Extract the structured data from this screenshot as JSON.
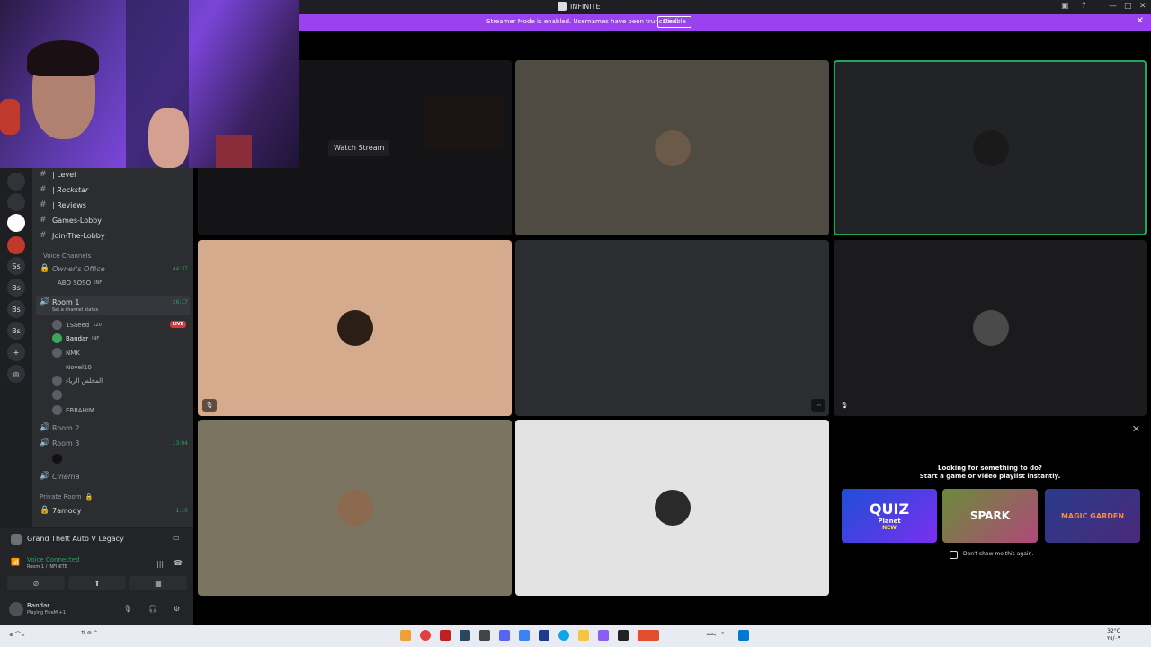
{
  "window": {
    "title": "INFINITE"
  },
  "banner": {
    "message": "Streamer Mode is enabled. Usernames have been truncated.",
    "disable_label": "Disable"
  },
  "servers": [
    "Ss",
    "Bs",
    "Bs",
    "Bs"
  ],
  "channels": {
    "text": [
      {
        "name": "| Level"
      },
      {
        "name": "| Rockstar"
      },
      {
        "name": "| Reviews"
      },
      {
        "name": "Games-Lobby"
      },
      {
        "name": "Join-The-Lobby"
      }
    ],
    "category": "Voice Channels",
    "owners_office": {
      "name": "Owner's Office",
      "time": "44:37",
      "member": "ABO SOSO",
      "badge": "INF"
    },
    "room1": {
      "name": "Room 1",
      "status": "Set a channel status",
      "time": "26:17",
      "live": "LIVE",
      "members": [
        {
          "name": "1Saeed",
          "badge": "120"
        },
        {
          "name": "Bandar",
          "badge": "INF"
        },
        {
          "name": "NMK"
        },
        {
          "name": "Novel10"
        },
        {
          "name": "المخلص الرياء"
        },
        {
          "name": ""
        },
        {
          "name": "EBRAHIM"
        }
      ]
    },
    "room2": {
      "name": "Room 2"
    },
    "room3": {
      "name": "Room 3",
      "time": "13:04"
    },
    "cinema": {
      "name": "Cinema"
    },
    "private": {
      "category": "Private Room",
      "name": "7amody",
      "time": "1:10"
    }
  },
  "game": {
    "name": "Grand Theft Auto V Legacy"
  },
  "voice": {
    "status": "Voice Connected",
    "room": "Room 1 / INFINITE"
  },
  "user": {
    "name": "Bandar",
    "status": "Playing FiveM +1"
  },
  "stage": {
    "watch_label": "Watch Stream"
  },
  "promo": {
    "heading1": "Looking for something to do?",
    "heading2": "Start a game or video playlist instantly.",
    "games": [
      {
        "title": "QUIZ",
        "subtitle": "Planet",
        "tag": "NEW"
      },
      {
        "title": "SPARK"
      },
      {
        "title": "MAGIC GARDEN"
      }
    ],
    "checkbox_label": "Don't show me this again."
  },
  "taskbar": {
    "search": "بحث",
    "temp": "32°C",
    "clock": "٢٥/٠٩"
  }
}
